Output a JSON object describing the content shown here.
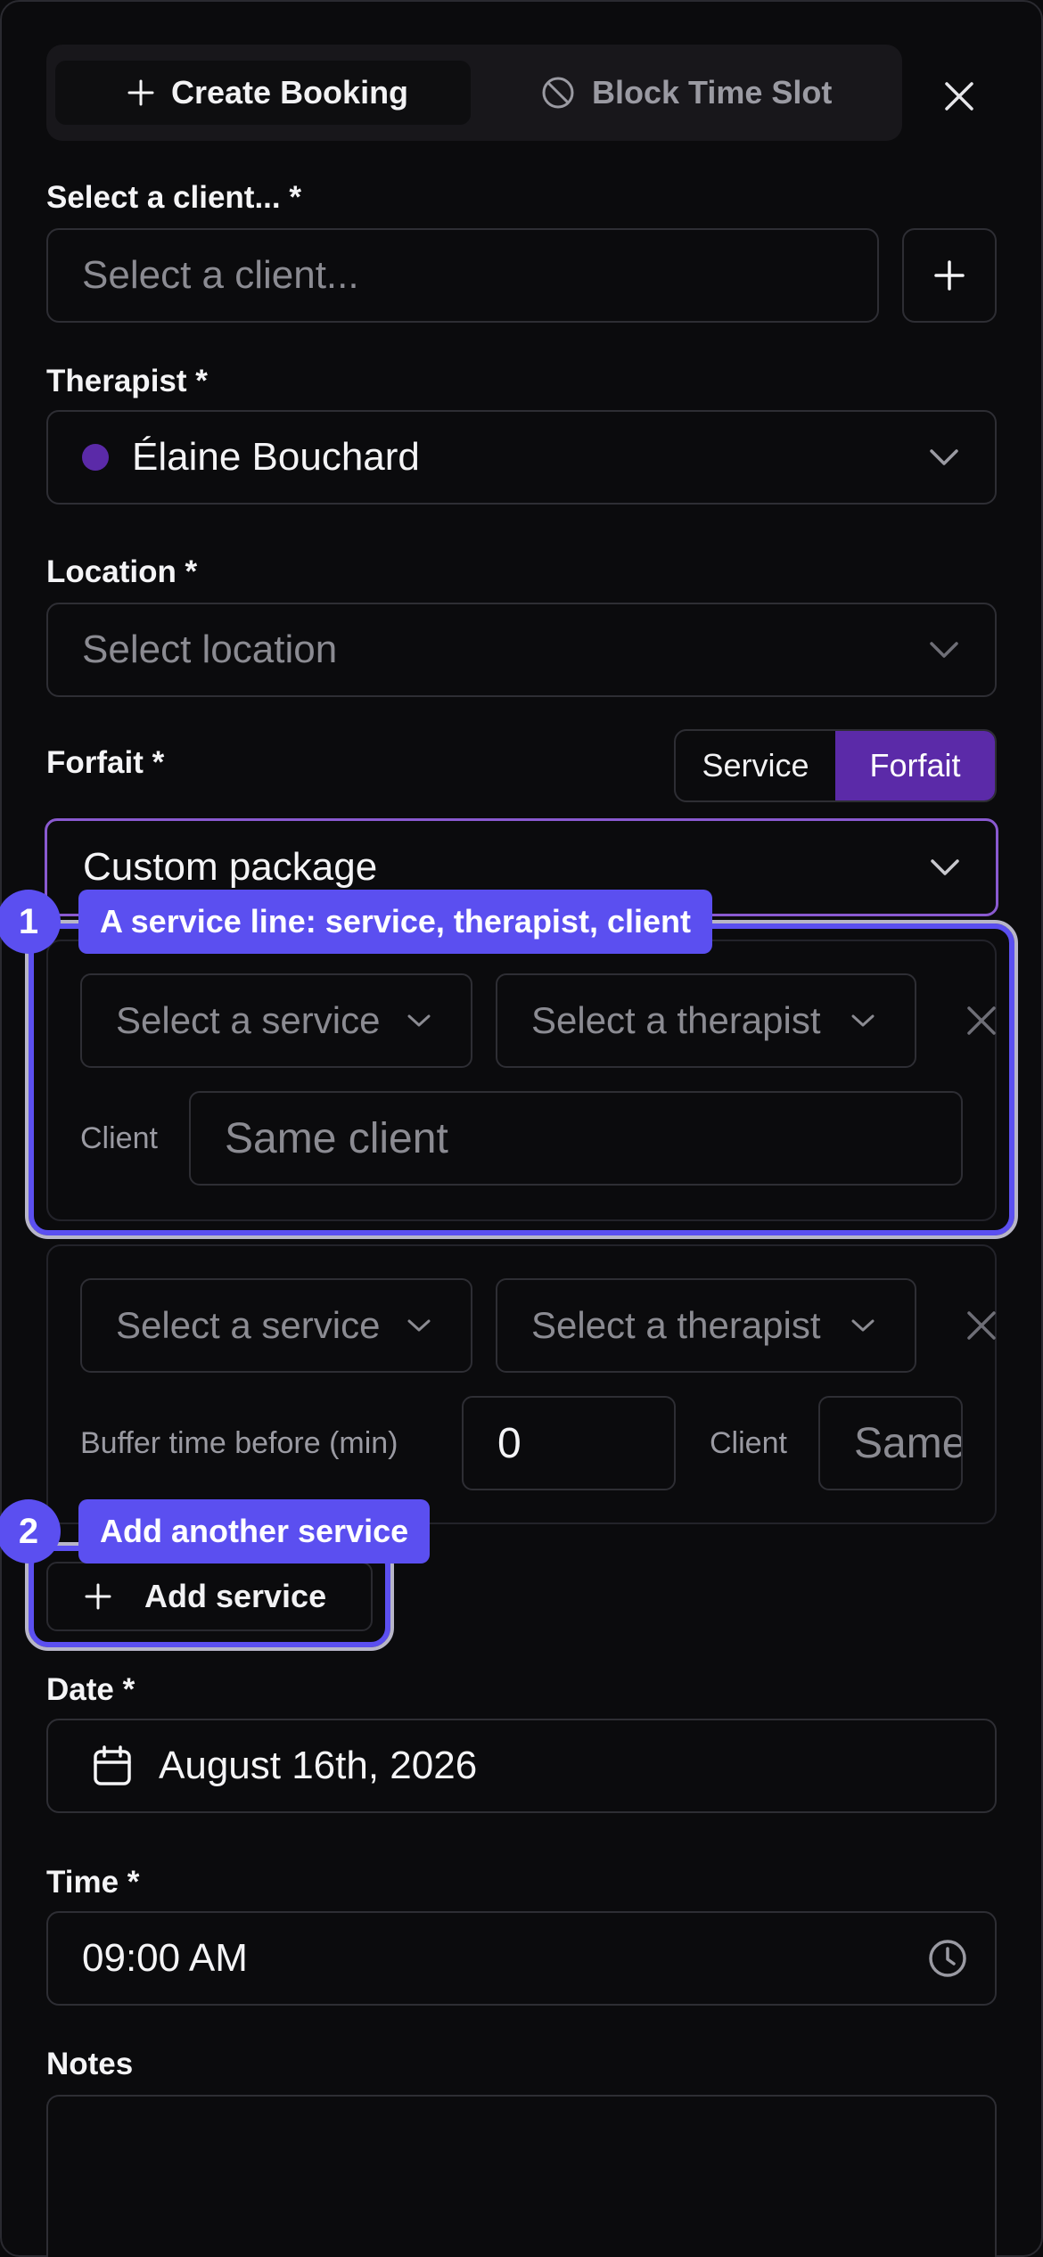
{
  "tabs": {
    "create_booking": "Create Booking",
    "block_time_slot": "Block Time Slot"
  },
  "client": {
    "label": "Select a client... *",
    "placeholder": "Select a client..."
  },
  "therapist": {
    "label": "Therapist *",
    "value": "Élaine Bouchard",
    "dot_color": "#5b2aa8"
  },
  "location": {
    "label": "Location *",
    "placeholder": "Select location"
  },
  "forfait": {
    "label": "Forfait *",
    "toggle_service": "Service",
    "toggle_forfait": "Forfait",
    "selected": "Forfait",
    "value": "Custom package"
  },
  "service_lines": [
    {
      "service_placeholder": "Select a service",
      "therapist_placeholder": "Select a therapist",
      "client_label": "Client",
      "client_placeholder": "Same client"
    },
    {
      "service_placeholder": "Select a service",
      "therapist_placeholder": "Select a therapist",
      "buffer_label": "Buffer time before (min)",
      "buffer_value": "0",
      "client_label": "Client",
      "client_placeholder": "Same client"
    }
  ],
  "add_service": "Add service",
  "annotations": [
    {
      "number": "1",
      "text": "A service line: service, therapist, client"
    },
    {
      "number": "2",
      "text": "Add another service"
    }
  ],
  "date": {
    "label": "Date *",
    "value": "August 16th, 2026"
  },
  "time": {
    "label": "Time *",
    "value": "09:00 AM"
  },
  "notes": {
    "label": "Notes",
    "value": ""
  },
  "colors": {
    "accent_purple": "#5b2aa8",
    "annotation_blue": "#5b4ff0",
    "background": "#0b0b0d"
  },
  "icons": [
    "plus-icon",
    "block-icon",
    "close-icon",
    "chevron-down-icon",
    "calendar-icon",
    "clock-icon"
  ]
}
